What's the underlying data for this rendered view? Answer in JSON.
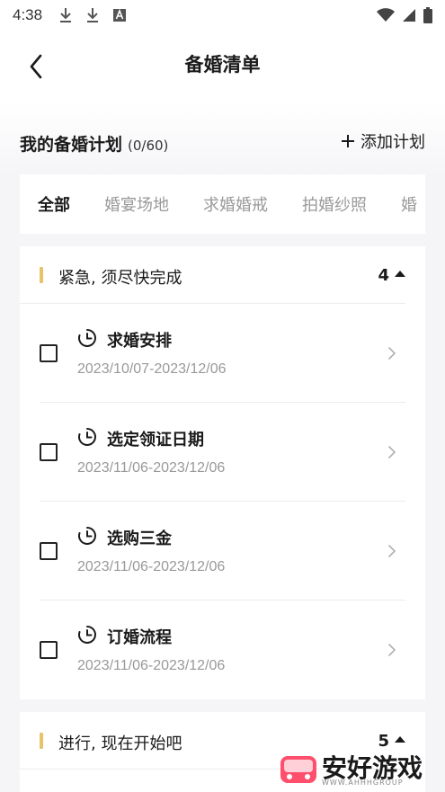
{
  "status_bar": {
    "time": "4:38"
  },
  "nav": {
    "title": "备婚清单"
  },
  "summary": {
    "title": "我的备婚计划",
    "count": "(0/60)",
    "add_label": "添加计划"
  },
  "tabs": [
    "全部",
    "婚宴场地",
    "求婚婚戒",
    "拍婚纱照",
    "婚"
  ],
  "groups": [
    {
      "title": "紧急, 须尽快完成",
      "count": "4",
      "tasks": [
        {
          "name": "求婚安排",
          "date": "2023/10/07-2023/12/06"
        },
        {
          "name": "选定领证日期",
          "date": "2023/11/06-2023/12/06"
        },
        {
          "name": "选购三金",
          "date": "2023/11/06-2023/12/06"
        },
        {
          "name": "订婚流程",
          "date": "2023/11/06-2023/12/06"
        }
      ]
    },
    {
      "title": "进行, 现在开始吧",
      "count": "5"
    }
  ],
  "watermark": {
    "text": "安好游戏",
    "sub": "WWW.AHHHGROUP"
  },
  "colors": {
    "accent_bar": "#e7c46a",
    "muted_text": "#999999",
    "background": "#f5f5f8"
  }
}
